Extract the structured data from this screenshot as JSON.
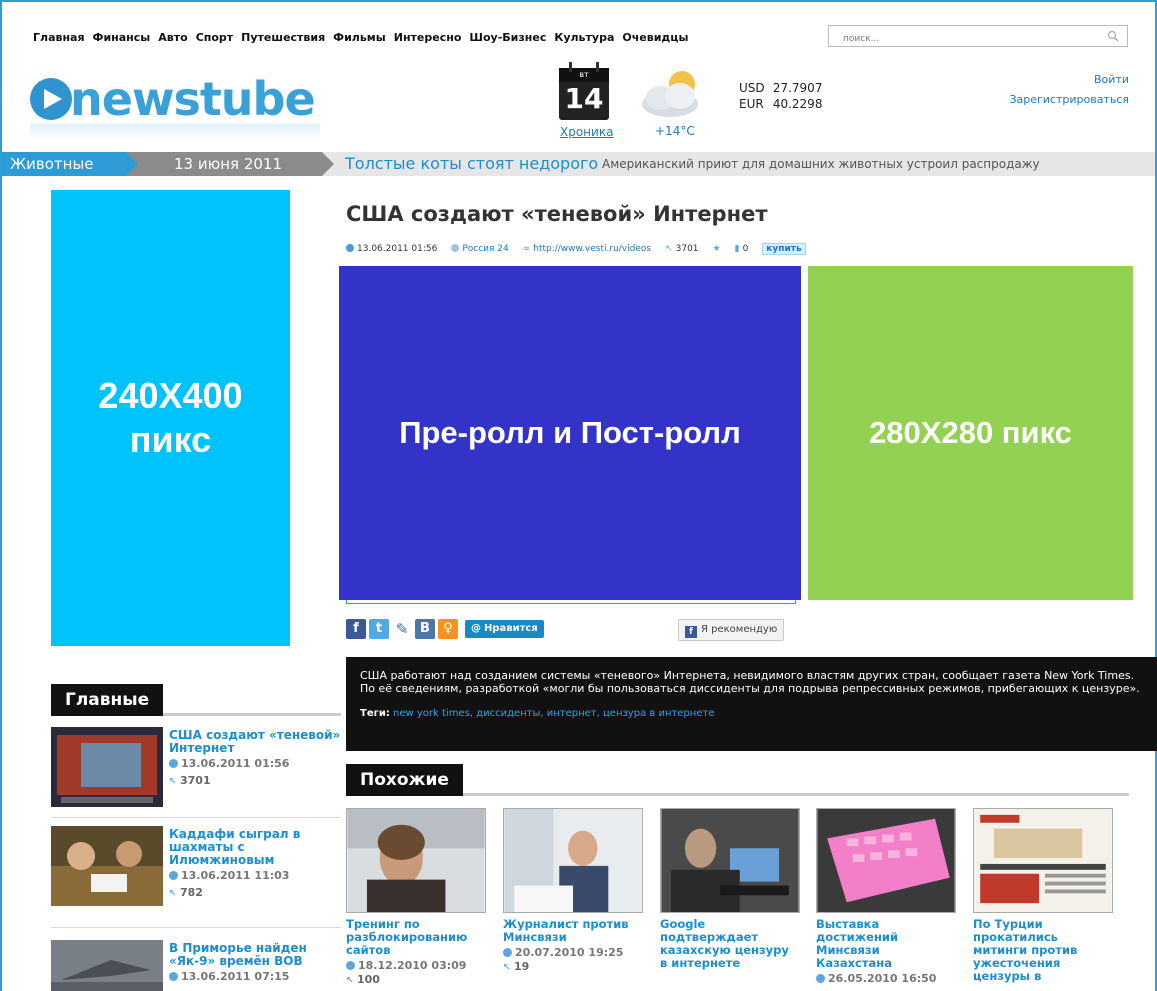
{
  "nav": [
    "Главная",
    "Финансы",
    "Авто",
    "Спорт",
    "Путешествия",
    "Фильмы",
    "Интересно",
    "Шоу-Бизнес",
    "Культура",
    "Очевидцы"
  ],
  "search": {
    "placeholder": "поиск..."
  },
  "logo": {
    "text": "newstube"
  },
  "calendar": {
    "dow": "вт",
    "day": "14",
    "link": "Хроника"
  },
  "weather": {
    "temp": "+14°C"
  },
  "rates": {
    "usd_label": "USD",
    "usd": "27.7907",
    "eur_label": "EUR",
    "eur": "40.2298"
  },
  "auth": {
    "login": "Войти",
    "register": "Зарегистрироваться"
  },
  "ticker": {
    "category": "Животные",
    "date": "13 июня 2011",
    "headline": "Толстые коты стоят недорого",
    "sub": "Американский приют для домашних животных устроил распродажу"
  },
  "ads": {
    "left": "240X400 пикс",
    "mid": "Пре-ролл и Пост-ролл",
    "right": "280X280 пикс"
  },
  "article": {
    "title": "США создают «теневой» Интернет",
    "date": "13.06.2011 01:56",
    "source": "Россия 24",
    "link": "http://www.vesti.ru/videos",
    "views": "3701",
    "comments": "0",
    "buy": "купить",
    "description": "США работают над созданием системы «теневого» Интернета, невидимого властям других стран, сообщает газета New York Times. По её сведениям, разработкой «могли бы пользоваться диссиденты для подрыва репрессивных режимов, прибегающих к цензуре».",
    "tags_label": "Теги:",
    "tags": "new york times, диссиденты, интернет, цензура в интернете"
  },
  "share": {
    "like": "Нравится",
    "recommend": "Я рекомендую"
  },
  "sections": {
    "main": "Главные",
    "similar": "Похожие"
  },
  "main_items": [
    {
      "title": "США создают «теневой» Интернет",
      "date": "13.06.2011 01:56",
      "views": "3701"
    },
    {
      "title": "Каддафи сыграл в шахматы с Илюмжиновым",
      "date": "13.06.2011 11:03",
      "views": "782"
    },
    {
      "title": "В Приморье найден «Як-9» времён ВОВ",
      "date": "13.06.2011 07:15",
      "views": ""
    }
  ],
  "related": [
    {
      "title": "Тренинг по разблокированию сайтов",
      "date": "18.12.2010 03:09",
      "views": "100"
    },
    {
      "title": "Журналист против Минсвязи",
      "date": "20.07.2010 19:25",
      "views": "19"
    },
    {
      "title": "Google подтверждает казахскую цензуру в интернете",
      "date": "",
      "views": ""
    },
    {
      "title": "Выставка достижений Минсвязи Казахстана",
      "date": "26.05.2010 16:50",
      "views": ""
    },
    {
      "title": "По Турции прокатились митинги против ужесточения цензуры в",
      "date": "",
      "views": ""
    }
  ],
  "colors": {
    "accent": "#2d9bd6",
    "ad_left": "#00c3fc",
    "ad_mid": "#3332c9",
    "ad_right": "#93d152"
  }
}
